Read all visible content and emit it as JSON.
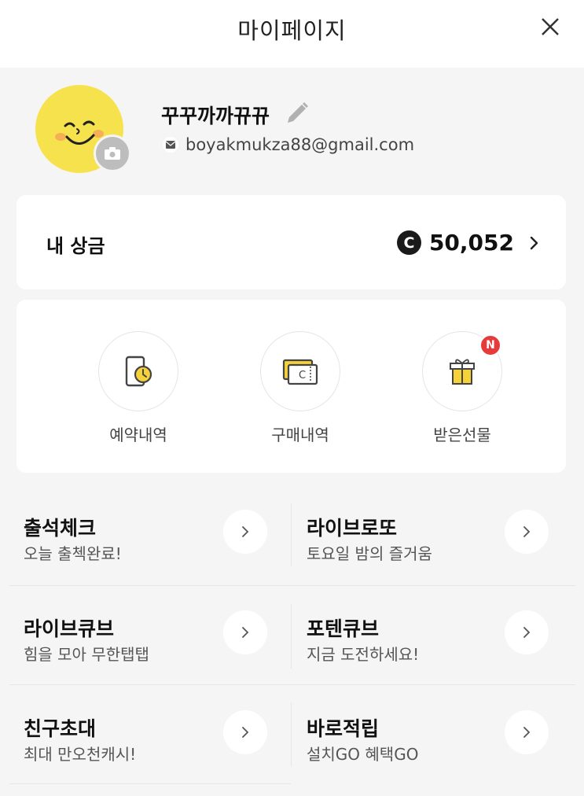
{
  "header": {
    "title": "마이페이지",
    "close_icon": "close-icon"
  },
  "profile": {
    "nickname": "꾸꾸까까뀨뀨",
    "email": "boyakmukza88@gmail.com",
    "avatar_color": "#f6e24d"
  },
  "prize": {
    "label": "내 상금",
    "coin_symbol": "C",
    "amount": "50,052"
  },
  "menu": [
    {
      "label": "예약내역",
      "icon": "reservation-history-icon"
    },
    {
      "label": "구매내역",
      "icon": "purchase-history-icon"
    },
    {
      "label": "받은선물",
      "icon": "gift-icon",
      "badge": "N"
    }
  ],
  "events": [
    {
      "title": "출석체크",
      "subtitle": "오늘 출첵완료!"
    },
    {
      "title": "라이브로또",
      "subtitle": "토요일 밤의 즐거움"
    },
    {
      "title": "라이브큐브",
      "subtitle": "힘을 모아 무한탭탭"
    },
    {
      "title": "포텐큐브",
      "subtitle": "지금 도전하세요!"
    },
    {
      "title": "친구초대",
      "subtitle": "최대 만오천캐시!"
    },
    {
      "title": "바로적립",
      "subtitle": "설치GO 혜택GO"
    }
  ],
  "colors": {
    "accent_yellow": "#f6e24d",
    "badge_red": "#e63b3b",
    "background": "#f5f5f5"
  }
}
